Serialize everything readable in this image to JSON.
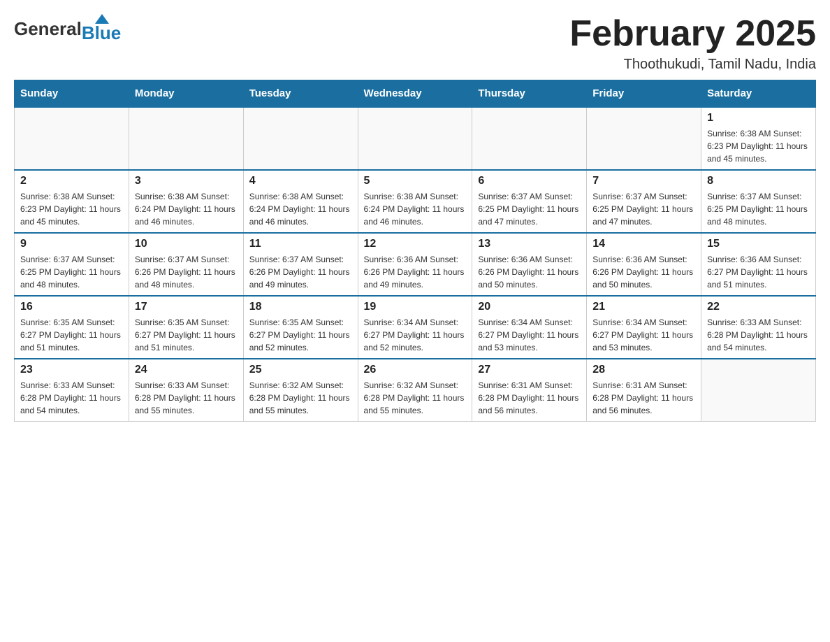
{
  "logo": {
    "general": "General",
    "blue": "Blue"
  },
  "title": "February 2025",
  "location": "Thoothukudi, Tamil Nadu, India",
  "weekdays": [
    "Sunday",
    "Monday",
    "Tuesday",
    "Wednesday",
    "Thursday",
    "Friday",
    "Saturday"
  ],
  "weeks": [
    [
      {
        "day": "",
        "info": ""
      },
      {
        "day": "",
        "info": ""
      },
      {
        "day": "",
        "info": ""
      },
      {
        "day": "",
        "info": ""
      },
      {
        "day": "",
        "info": ""
      },
      {
        "day": "",
        "info": ""
      },
      {
        "day": "1",
        "info": "Sunrise: 6:38 AM\nSunset: 6:23 PM\nDaylight: 11 hours and 45 minutes."
      }
    ],
    [
      {
        "day": "2",
        "info": "Sunrise: 6:38 AM\nSunset: 6:23 PM\nDaylight: 11 hours and 45 minutes."
      },
      {
        "day": "3",
        "info": "Sunrise: 6:38 AM\nSunset: 6:24 PM\nDaylight: 11 hours and 46 minutes."
      },
      {
        "day": "4",
        "info": "Sunrise: 6:38 AM\nSunset: 6:24 PM\nDaylight: 11 hours and 46 minutes."
      },
      {
        "day": "5",
        "info": "Sunrise: 6:38 AM\nSunset: 6:24 PM\nDaylight: 11 hours and 46 minutes."
      },
      {
        "day": "6",
        "info": "Sunrise: 6:37 AM\nSunset: 6:25 PM\nDaylight: 11 hours and 47 minutes."
      },
      {
        "day": "7",
        "info": "Sunrise: 6:37 AM\nSunset: 6:25 PM\nDaylight: 11 hours and 47 minutes."
      },
      {
        "day": "8",
        "info": "Sunrise: 6:37 AM\nSunset: 6:25 PM\nDaylight: 11 hours and 48 minutes."
      }
    ],
    [
      {
        "day": "9",
        "info": "Sunrise: 6:37 AM\nSunset: 6:25 PM\nDaylight: 11 hours and 48 minutes."
      },
      {
        "day": "10",
        "info": "Sunrise: 6:37 AM\nSunset: 6:26 PM\nDaylight: 11 hours and 48 minutes."
      },
      {
        "day": "11",
        "info": "Sunrise: 6:37 AM\nSunset: 6:26 PM\nDaylight: 11 hours and 49 minutes."
      },
      {
        "day": "12",
        "info": "Sunrise: 6:36 AM\nSunset: 6:26 PM\nDaylight: 11 hours and 49 minutes."
      },
      {
        "day": "13",
        "info": "Sunrise: 6:36 AM\nSunset: 6:26 PM\nDaylight: 11 hours and 50 minutes."
      },
      {
        "day": "14",
        "info": "Sunrise: 6:36 AM\nSunset: 6:26 PM\nDaylight: 11 hours and 50 minutes."
      },
      {
        "day": "15",
        "info": "Sunrise: 6:36 AM\nSunset: 6:27 PM\nDaylight: 11 hours and 51 minutes."
      }
    ],
    [
      {
        "day": "16",
        "info": "Sunrise: 6:35 AM\nSunset: 6:27 PM\nDaylight: 11 hours and 51 minutes."
      },
      {
        "day": "17",
        "info": "Sunrise: 6:35 AM\nSunset: 6:27 PM\nDaylight: 11 hours and 51 minutes."
      },
      {
        "day": "18",
        "info": "Sunrise: 6:35 AM\nSunset: 6:27 PM\nDaylight: 11 hours and 52 minutes."
      },
      {
        "day": "19",
        "info": "Sunrise: 6:34 AM\nSunset: 6:27 PM\nDaylight: 11 hours and 52 minutes."
      },
      {
        "day": "20",
        "info": "Sunrise: 6:34 AM\nSunset: 6:27 PM\nDaylight: 11 hours and 53 minutes."
      },
      {
        "day": "21",
        "info": "Sunrise: 6:34 AM\nSunset: 6:27 PM\nDaylight: 11 hours and 53 minutes."
      },
      {
        "day": "22",
        "info": "Sunrise: 6:33 AM\nSunset: 6:28 PM\nDaylight: 11 hours and 54 minutes."
      }
    ],
    [
      {
        "day": "23",
        "info": "Sunrise: 6:33 AM\nSunset: 6:28 PM\nDaylight: 11 hours and 54 minutes."
      },
      {
        "day": "24",
        "info": "Sunrise: 6:33 AM\nSunset: 6:28 PM\nDaylight: 11 hours and 55 minutes."
      },
      {
        "day": "25",
        "info": "Sunrise: 6:32 AM\nSunset: 6:28 PM\nDaylight: 11 hours and 55 minutes."
      },
      {
        "day": "26",
        "info": "Sunrise: 6:32 AM\nSunset: 6:28 PM\nDaylight: 11 hours and 55 minutes."
      },
      {
        "day": "27",
        "info": "Sunrise: 6:31 AM\nSunset: 6:28 PM\nDaylight: 11 hours and 56 minutes."
      },
      {
        "day": "28",
        "info": "Sunrise: 6:31 AM\nSunset: 6:28 PM\nDaylight: 11 hours and 56 minutes."
      },
      {
        "day": "",
        "info": ""
      }
    ]
  ]
}
